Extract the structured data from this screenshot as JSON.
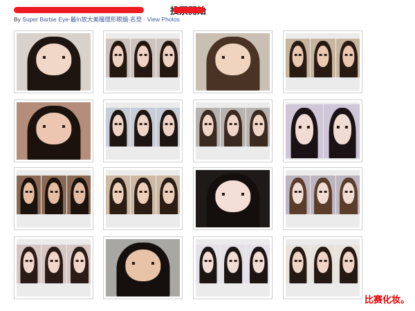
{
  "header": {
    "title_visible": "投票開始",
    "byline_prefix": "By",
    "author": "Super Barbie Eye-",
    "album_text": "最In放大美瞳隱形眼鏡",
    "album_suffix": "-名登",
    "view_photos": "View Photos"
  },
  "colors": {
    "redaction": "#ee1b24",
    "link": "#3b5998",
    "caption": "#e60000",
    "card_border": "#cfcfcf",
    "card_fill": "#ebebeb"
  },
  "photos": [
    {
      "kind": "single",
      "bg": "#d9d2cc",
      "skin": "#f1d7c8",
      "hair": "#1e1410"
    },
    {
      "kind": "collage3",
      "bg": "#cfc3bd",
      "skin": "#efd2c3",
      "hair": "#24170f"
    },
    {
      "kind": "single",
      "bg": "#c9bfb2",
      "skin": "#f0d4bf",
      "hair": "#4a3224"
    },
    {
      "kind": "collage3",
      "bg": "#c8b59f",
      "skin": "#ebc9b1",
      "hair": "#2a1b12"
    },
    {
      "kind": "single",
      "bg": "#b48e7a",
      "skin": "#ecc6b0",
      "hair": "#1b120d"
    },
    {
      "kind": "collage3",
      "bg": "#c7ccd6",
      "skin": "#eed3c6",
      "hair": "#1d1512"
    },
    {
      "kind": "collage3",
      "bg": "#b9b3af",
      "skin": "#f0d6c8",
      "hair": "#3a2a1f"
    },
    {
      "kind": "collage2",
      "bg": "#cfc6d8",
      "skin": "#f1dcd3",
      "hair": "#1a1214"
    },
    {
      "kind": "collage3",
      "bg": "#8b6a55",
      "skin": "#e5bda2",
      "hair": "#1b120c"
    },
    {
      "kind": "collage3",
      "bg": "#cdb9a4",
      "skin": "#ecd0bb",
      "hair": "#2c1d14"
    },
    {
      "kind": "single",
      "bg": "#1e1a1a",
      "skin": "#f3dfd6",
      "hair": "#140e0c"
    },
    {
      "kind": "collage3",
      "bg": "#bdb5bf",
      "skin": "#f1ddd4",
      "hair": "#5a3d2b"
    },
    {
      "kind": "collage3",
      "bg": "#d7c7c3",
      "skin": "#f1d6ca",
      "hair": "#2a1b16"
    },
    {
      "kind": "single",
      "bg": "#a8a7a3",
      "skin": "#e8c3a7",
      "hair": "#15100d"
    },
    {
      "kind": "collage3",
      "bg": "#e4e1e8",
      "skin": "#f2ddd4",
      "hair": "#1c1514"
    },
    {
      "kind": "collage3",
      "bg": "#e8e4dc",
      "skin": "#f0d5c6",
      "hair": "#251913"
    }
  ],
  "footer": {
    "caption": "比赛化妆。"
  }
}
